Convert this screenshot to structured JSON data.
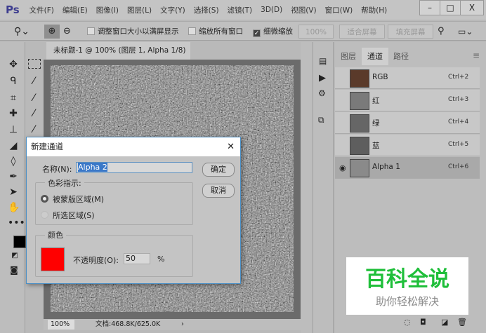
{
  "app": {
    "logo": "Ps"
  },
  "menu": [
    "文件(F)",
    "编辑(E)",
    "图像(I)",
    "图层(L)",
    "文字(Y)",
    "选择(S)",
    "滤镜(T)",
    "3D(D)",
    "视图(V)",
    "窗口(W)",
    "帮助(H)"
  ],
  "window_controls": {
    "minimize": "–",
    "maximize": "□",
    "close": "X"
  },
  "options": {
    "resize_windows": "调整窗口大小以满屏显示",
    "zoom_all": "缩放所有窗口",
    "scrubby_zoom": "细微缩放",
    "scrubby_checked": true,
    "zoom_value": "100%",
    "fit_screen": "适合屏幕",
    "fill_screen": "填充屏幕"
  },
  "document": {
    "tab": "未标题-1 @ 100% (图层 1, Alpha 1/8) *",
    "close": "×",
    "zoom": "100%",
    "doc_info": "文档:468.8K/625.0K",
    "arrow": "›"
  },
  "panel": {
    "tabs": [
      "图层",
      "通道",
      "路径"
    ],
    "active_tab": "通道",
    "channels": [
      {
        "name": "RGB",
        "shortcut": "Ctrl+2",
        "visible": false,
        "thumb": "#5a3a2a"
      },
      {
        "name": "红",
        "shortcut": "Ctrl+3",
        "visible": false,
        "thumb": "#7a7a7a"
      },
      {
        "name": "绿",
        "shortcut": "Ctrl+4",
        "visible": false,
        "thumb": "#666"
      },
      {
        "name": "蓝",
        "shortcut": "Ctrl+5",
        "visible": false,
        "thumb": "#5e5e5e"
      },
      {
        "name": "Alpha 1",
        "shortcut": "Ctrl+6",
        "visible": true,
        "thumb": "#8a8a8a"
      }
    ]
  },
  "dialog": {
    "title": "新建通道",
    "close": "✕",
    "name_label": "名称(N):",
    "name_value": "Alpha 2",
    "ok": "确定",
    "cancel": "取消",
    "color_indicates": "色彩指示:",
    "masked_areas": "被蒙版区域(M)",
    "selected_areas": "所选区域(S)",
    "color_group": "颜色",
    "opacity_label": "不透明度(O):",
    "opacity_value": "50",
    "percent": "%",
    "color": "#ff0000"
  },
  "watermark": {
    "title": "百科全说",
    "subtitle": "助你轻松解决"
  }
}
